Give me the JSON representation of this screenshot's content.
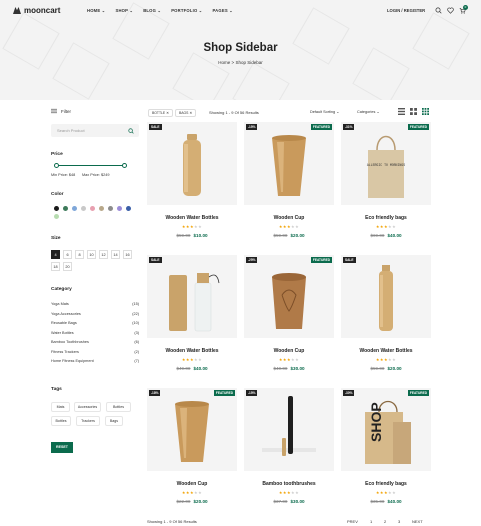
{
  "nav": {
    "logo": "mooncart",
    "menu": [
      "HOME",
      "SHOP",
      "BLOG",
      "PORTFOLIO",
      "PAGES"
    ],
    "login": "LOGIN / REGISTER",
    "cart_count": "0"
  },
  "hero": {
    "title": "Shop Sidebar",
    "crumb_home": "Home",
    "crumb_sep": ">",
    "crumb_current": "Shop Sidebar"
  },
  "sidebar": {
    "filter_label": "Filter",
    "search_placeholder": "Search Product",
    "price_title": "Price",
    "min_price": "Min Price: $48",
    "max_price": "Max Price: $249",
    "color_title": "Color",
    "colors": [
      "#1a1a1a",
      "#3d7a5a",
      "#7fa7d9",
      "#c9c9c9",
      "#e8a0b0",
      "#b8a88a",
      "#8c8c8c",
      "#9c8cd8",
      "#3b5fa8",
      "#b7dcb0"
    ],
    "size_title": "Size",
    "sizes": [
      "4",
      "6",
      "8",
      "10",
      "12",
      "14",
      "16",
      "18",
      "20"
    ],
    "selected_size": "4",
    "category_title": "Category",
    "categories": [
      {
        "name": "Yoga Mats",
        "count": "(15)"
      },
      {
        "name": "Yoga Accessories",
        "count": "(22)"
      },
      {
        "name": "Reusable Bags",
        "count": "(10)"
      },
      {
        "name": "Water Bottles",
        "count": "(3)"
      },
      {
        "name": "Bamboo Toothbrushes",
        "count": "(6)"
      },
      {
        "name": "Fitness Trackers",
        "count": "(2)"
      },
      {
        "name": "Home Fitness Equipment",
        "count": "(7)"
      }
    ],
    "tags_title": "Tags",
    "tags": [
      "Mats",
      "Accessories",
      "Bottles",
      "Bottles",
      "Trackers",
      "Bags"
    ],
    "reset": "RESET"
  },
  "toolbar": {
    "chips": [
      "BOTTLE",
      "BAGS"
    ],
    "showing": "Showing 1 - 9 Of 56 Results",
    "sort": "Default Sorting",
    "categories": "Categories"
  },
  "products": [
    {
      "name": "Wooden Water Bottles",
      "old": "$59.00",
      "new": "$10.00",
      "rating": 3,
      "left": "SALE",
      "right": ""
    },
    {
      "name": "Wooden Cup",
      "old": "$59.00",
      "new": "$20.00",
      "rating": 3,
      "left": "-15%",
      "right": "FEATURED"
    },
    {
      "name": "Eco friendly bags",
      "old": "$69.00",
      "new": "$40.00",
      "rating": 3,
      "left": "-31%",
      "right": "FEATURED"
    },
    {
      "name": "Wooden Water Bottles",
      "old": "$49.00",
      "new": "$40.00",
      "rating": 3,
      "left": "SALE",
      "right": ""
    },
    {
      "name": "Wooden Cup",
      "old": "$40.00",
      "new": "$30.00",
      "rating": 3,
      "left": "-25%",
      "right": "FEATURED"
    },
    {
      "name": "Wooden Water Bottles",
      "old": "$59.00",
      "new": "$20.00",
      "rating": 3,
      "left": "SALE",
      "right": ""
    },
    {
      "name": "Wooden Cup",
      "old": "$22.00",
      "new": "$20.00",
      "rating": 3,
      "left": "-18%",
      "right": "FEATURED"
    },
    {
      "name": "Bamboo toothbrushes",
      "old": "$37.00",
      "new": "$30.00",
      "rating": 3,
      "left": "-15%",
      "right": ""
    },
    {
      "name": "Eco friendly bags",
      "old": "$35.00",
      "new": "$40.00",
      "rating": 3,
      "left": "-30%",
      "right": "FEATURED"
    }
  ],
  "bag_text": "ALLERGIC TO MORNINGS",
  "bag2_text": "SHOP",
  "footer": {
    "showing": "Showing 1 - 9 Of 56 Results",
    "prev": "PREV",
    "pages": [
      "1",
      "2",
      "3"
    ],
    "next": "NEXT"
  }
}
